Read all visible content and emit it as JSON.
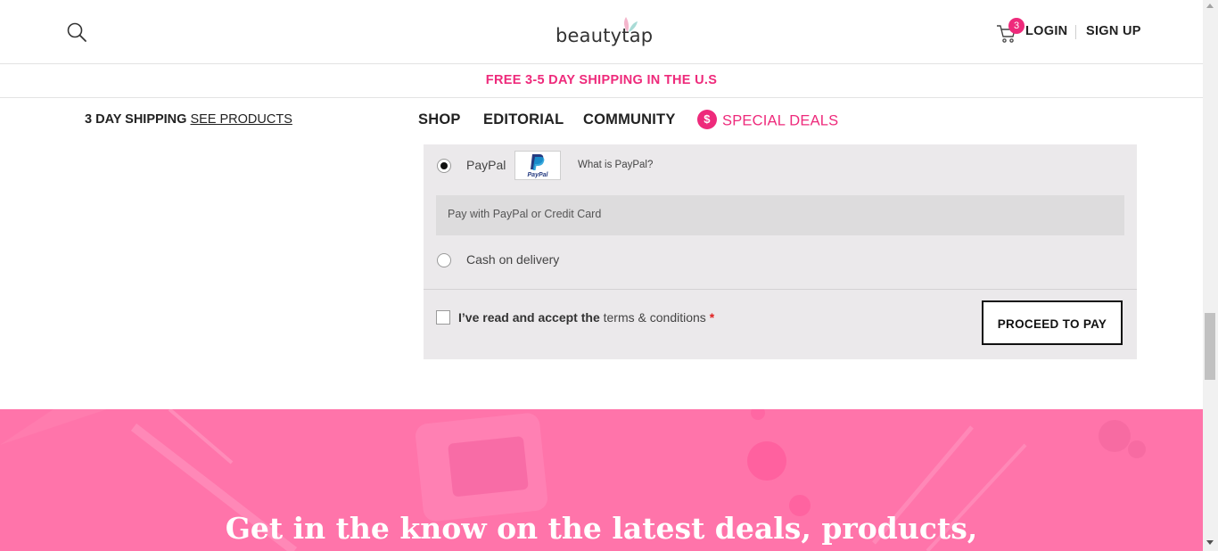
{
  "header": {
    "logo_text": "beautytap",
    "cart_count": "3",
    "login_label": "LOGIN",
    "signup_label": "SIGN UP"
  },
  "promo": {
    "text": "FREE 3-5 DAY SHIPPING IN THE U.S"
  },
  "subnav": {
    "shipping_label": "3 DAY SHIPPING",
    "see_products_label": "SEE PRODUCTS"
  },
  "nav": {
    "items": [
      {
        "label": "SHOP"
      },
      {
        "label": "EDITORIAL"
      },
      {
        "label": "COMMUNITY"
      },
      {
        "label": "SPECIAL DEALS",
        "icon_text": "$"
      }
    ]
  },
  "payment": {
    "paypal_label": "PayPal",
    "paypal_logo_text": "PayPal",
    "paypal_selected": true,
    "what_is_paypal": "What is PayPal?",
    "paypal_description": "Pay with PayPal or Credit Card",
    "cod_label": "Cash on delivery",
    "terms_bold": "I’ve read and accept the",
    "terms_link": "terms & conditions",
    "terms_required": "*",
    "proceed_label": "PROCEED TO PAY"
  },
  "hero": {
    "title": "Get in the know on the latest deals, products,"
  },
  "colors": {
    "brand_pink": "#ee2a7b",
    "hero_pink": "#ff74aa",
    "payment_bg": "#ebe9eb"
  },
  "icons": [
    "search-icon",
    "cart-icon",
    "logo-leaf-icon",
    "paypal-logo-icon",
    "dollar-icon"
  ]
}
